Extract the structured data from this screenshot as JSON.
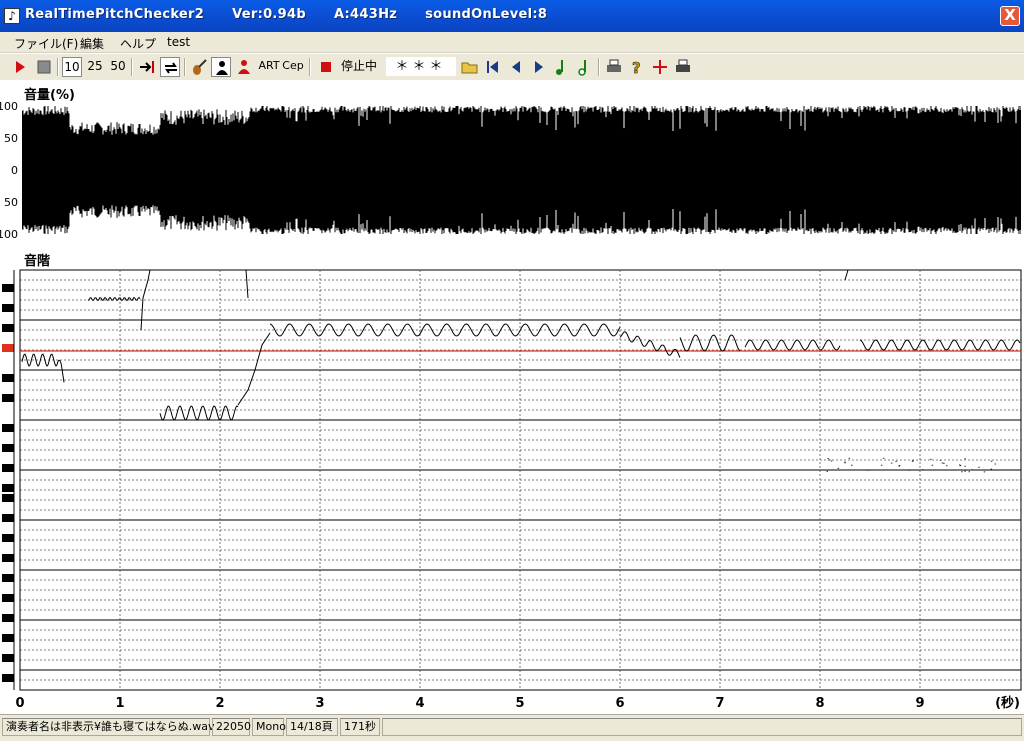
{
  "window": {
    "title_app": "RealTimePitchChecker2",
    "title_version": "Ver:0.94b",
    "title_a": "A:443Hz",
    "title_level": "soundOnLevel:8",
    "close_glyph": "X"
  },
  "menu": [
    "ファイル(F)",
    "編集",
    "ヘルプ",
    "test"
  ],
  "toolbar": {
    "play_icon": "play-icon",
    "stop_icon": "stop-icon",
    "speed_10": "10",
    "speed_25": "25",
    "speed_50": "50",
    "art_label": "ART",
    "cep_label": "Cep",
    "state_label": "停止中",
    "status_value": "＊＊＊"
  },
  "volume_panel": {
    "title": "音量(%)",
    "tick_labels": [
      "100",
      "50",
      "0",
      "50",
      "100"
    ]
  },
  "pitch_panel": {
    "title": "音階",
    "x_ticks": [
      "0",
      "1",
      "2",
      "3",
      "4",
      "5",
      "6",
      "7",
      "8",
      "9"
    ],
    "x_unit": "(秒)",
    "highlight_color": "#e0301e",
    "trace_color": "#000000"
  },
  "statusbar": {
    "file": "演奏者名は非表示¥誰も寝てはならぬ.wav",
    "rate": "22050",
    "channels": "Mono",
    "page": "14/18頁",
    "duration": "171秒"
  }
}
